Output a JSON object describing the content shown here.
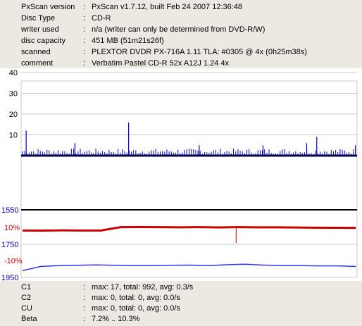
{
  "info": [
    {
      "key": "PxScan version",
      "value": "PxScan v1.7.12, built Feb 24 2007 12:36:48"
    },
    {
      "key": "Disc Type",
      "value": "CD-R"
    },
    {
      "key": "writer used",
      "value": "n/a (writer can only be determined from DVD-R/W)"
    },
    {
      "key": "disc capacity",
      "value": "451 MB (51m21s26f)"
    },
    {
      "key": "scanned",
      "value": "PLEXTOR DVDR PX-716A 1.11 TLA: #0305 @ 4x (0h25m38s)"
    },
    {
      "key": "comment",
      "value": "Verbatim Pastel CD-R 52x A12J 1.24 4x"
    }
  ],
  "separator": ":",
  "stats": [
    {
      "key": "C1",
      "value": "max: 17, total: 992, avg: 0.3/s"
    },
    {
      "key": "C2",
      "value": "max: 0, total: 0, avg: 0.0/s"
    },
    {
      "key": "CU",
      "value": "max: 0, total: 0, avg: 0.0/s"
    },
    {
      "key": "Beta",
      "value": "7.2% .. 10.3%"
    }
  ],
  "colors": {
    "c1_series": "#0000cc",
    "baseline": "#000044",
    "beta_series": "#cc0000",
    "jitter_series": "#3333ff",
    "gridline": "#c8c8c8",
    "jitter_label": "#0000cc",
    "beta_label": "#cc0000"
  },
  "chart_data": [
    {
      "type": "bar",
      "series": [
        {
          "name": "C1",
          "max": 17
        }
      ],
      "y_ticks": [
        "10",
        "20",
        "30",
        "40"
      ],
      "ylim": [
        0,
        50
      ],
      "spikes": [
        {
          "x": 0.015,
          "v": 12
        },
        {
          "x": 0.16,
          "v": 6
        },
        {
          "x": 0.32,
          "v": 16
        },
        {
          "x": 0.53,
          "v": 5
        },
        {
          "x": 0.72,
          "v": 5
        },
        {
          "x": 0.85,
          "v": 6
        },
        {
          "x": 0.88,
          "v": 9
        },
        {
          "x": 0.995,
          "v": 5
        }
      ],
      "grid": true
    },
    {
      "type": "line",
      "series": [
        {
          "name": "Beta",
          "values": [
            7.3,
            7.2,
            7.4,
            7.3,
            7.3,
            10.2,
            10.3,
            10.2,
            10.1,
            10.2,
            10.0,
            10.2,
            10.1,
            10.1,
            9.9,
            9.8,
            9.7,
            9.6
          ]
        }
      ],
      "y_ticks_beta": [
        "10%",
        "-10%"
      ],
      "y_ticks_jitter": [
        "1550",
        "1750",
        "1950"
      ],
      "grid": true
    },
    {
      "type": "line",
      "series": [
        {
          "name": "Jitter",
          "values": [
            1910,
            1885,
            1880,
            1878,
            1876,
            1878,
            1880,
            1880,
            1878,
            1877,
            1880,
            1875,
            1872,
            1877,
            1880,
            1880,
            1882,
            1882,
            1885
          ]
        }
      ],
      "ylim": [
        1550,
        1950
      ]
    }
  ]
}
